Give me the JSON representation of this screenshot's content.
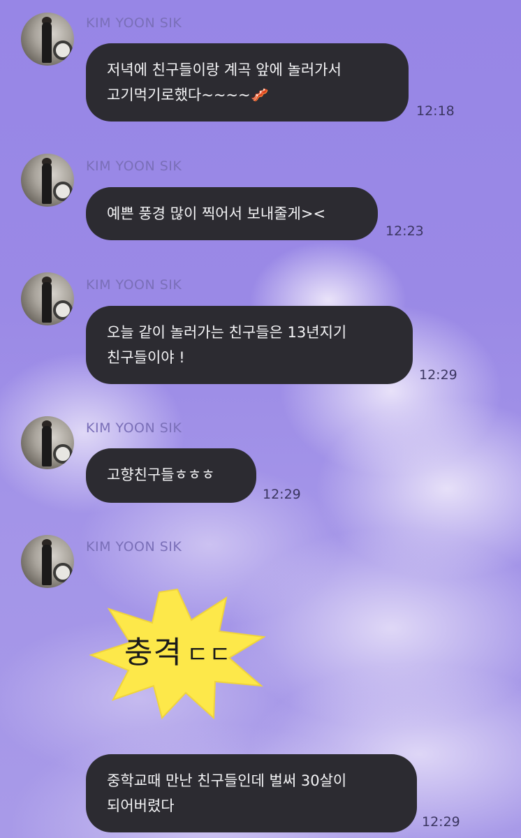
{
  "contact_name": "KIM YOON SIK",
  "messages": [
    {
      "text": "저녁에 친구들이랑 계곡 앞에 놀러가서\n고기먹기로했다~~~~🥓",
      "time": "12:18"
    },
    {
      "text": "예쁜 풍경 많이 찍어서 보내줄게><",
      "time": "12:23"
    },
    {
      "text": "오늘 같이 놀러가는 친구들은 13년지기\n친구들이야 !",
      "time": "12:29"
    },
    {
      "text": "고향친구들ㅎㅎㅎ",
      "time": "12:29"
    },
    {
      "text": "중학교때 만난 친구들인데 벌써 30살이\n되어버렸다",
      "time": "12:29"
    }
  ],
  "sticker": {
    "main": "충격",
    "suffix": "ㄷㄷ",
    "color": "#fde84a"
  },
  "colors": {
    "bubble": "#2c2b31",
    "bubble_text": "#f5f5f7",
    "background": "#9b8ae6"
  }
}
